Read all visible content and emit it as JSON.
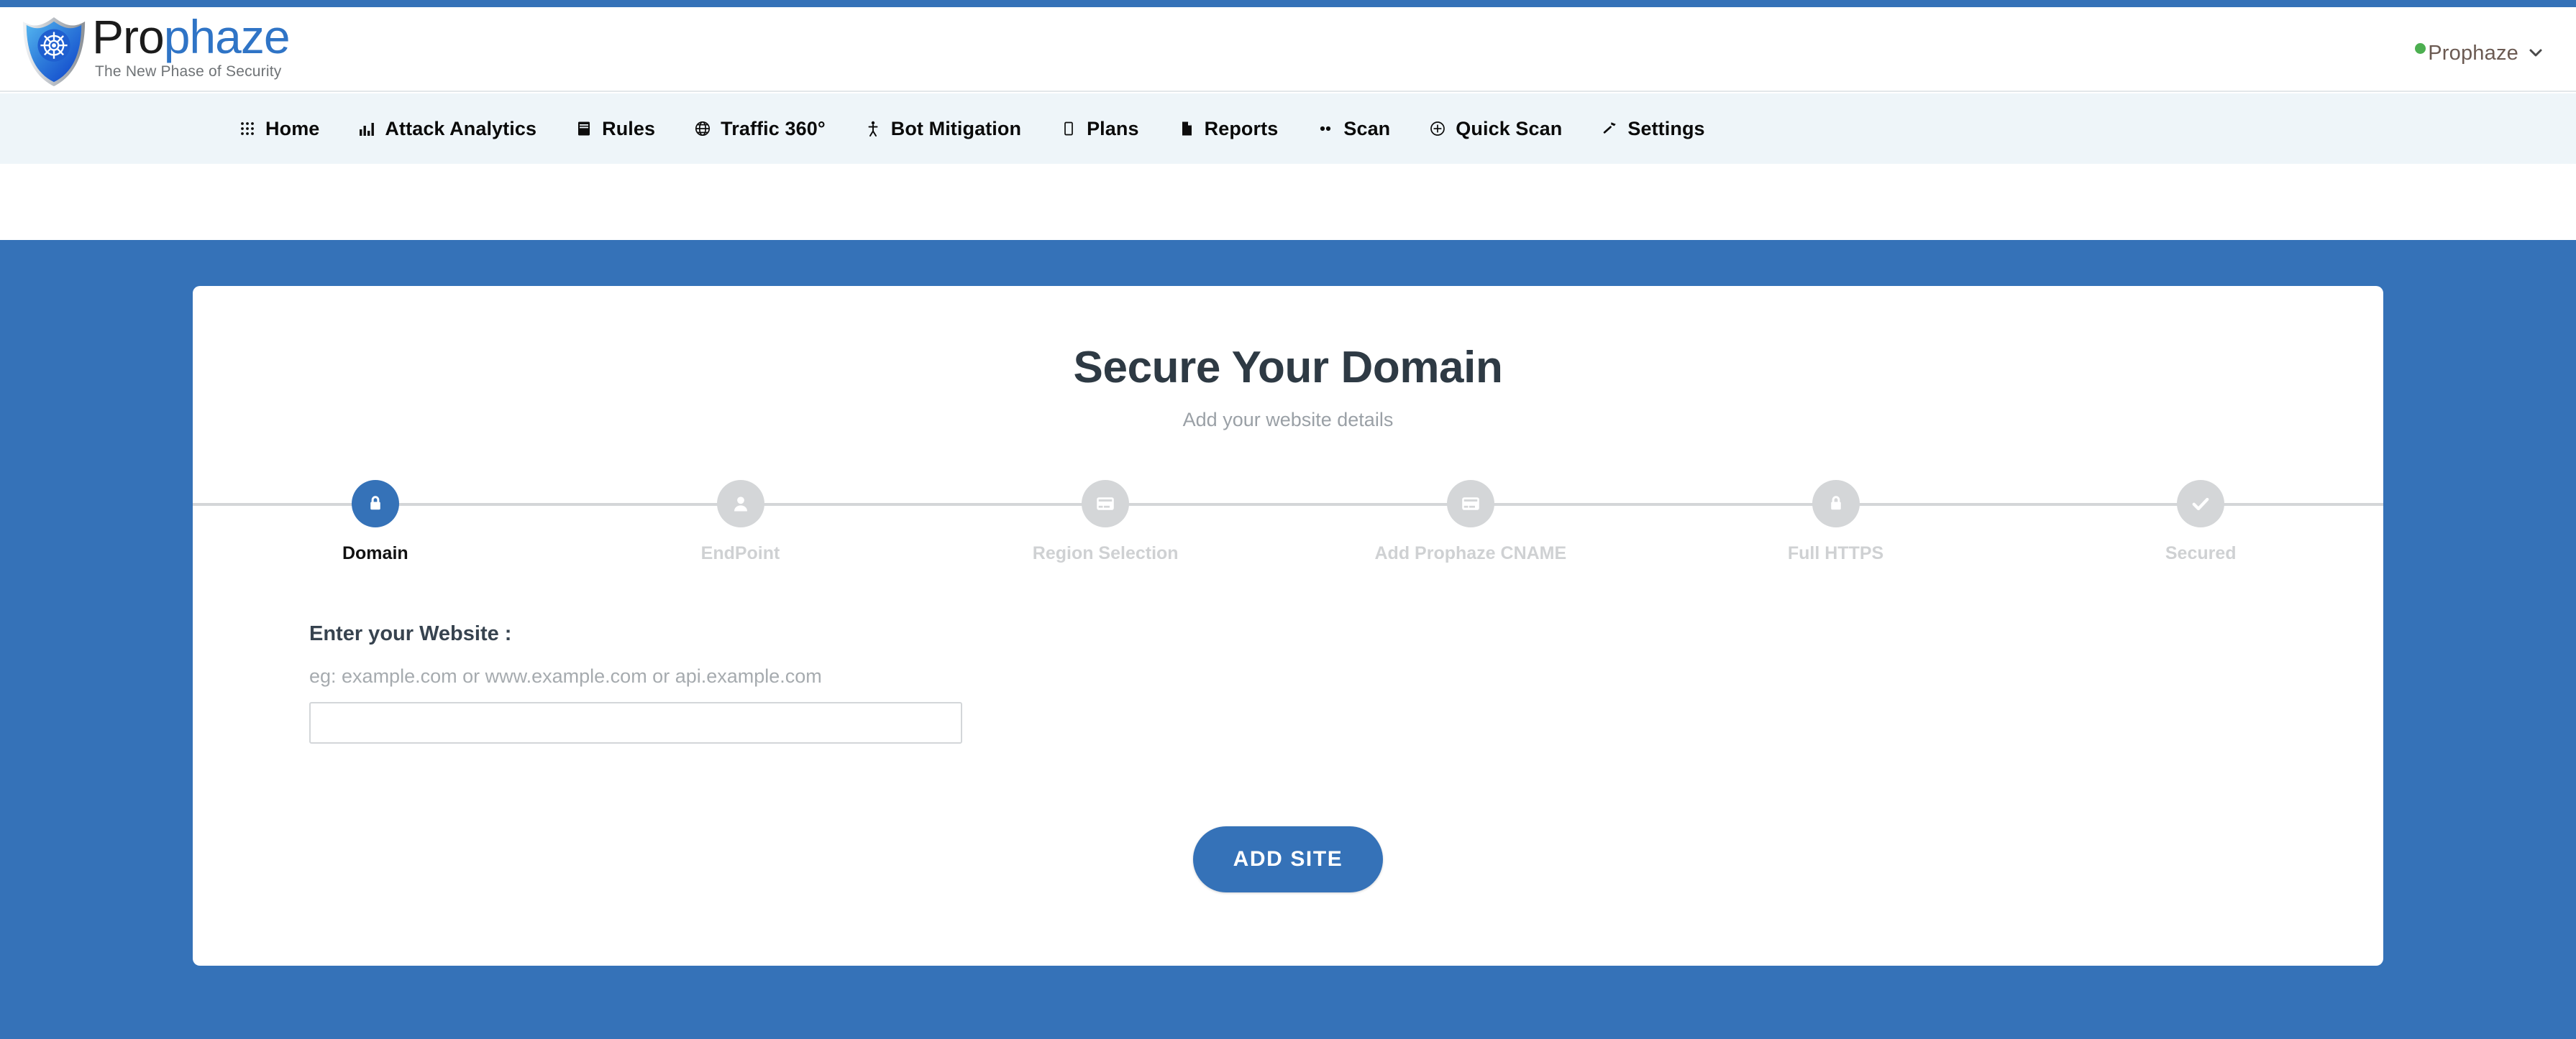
{
  "brand": {
    "name_prefix": "Pro",
    "name_suffix": "phaze",
    "tagline": "The New Phase of Security",
    "logo_icon": "shield-helm-icon"
  },
  "header": {
    "user_label": "Prophaze",
    "status_dot_color": "#4caf50",
    "chevron": "⌄"
  },
  "nav": {
    "items": [
      {
        "label": "Home",
        "icon": "grid-icon"
      },
      {
        "label": "Attack Analytics",
        "icon": "bar-chart-icon"
      },
      {
        "label": "Rules",
        "icon": "book-icon"
      },
      {
        "label": "Traffic 360°",
        "icon": "globe-icon"
      },
      {
        "label": "Bot Mitigation",
        "icon": "person-icon"
      },
      {
        "label": "Plans",
        "icon": "card-outline-icon"
      },
      {
        "label": "Reports",
        "icon": "document-icon"
      },
      {
        "label": "Scan",
        "icon": "eyes-icon"
      },
      {
        "label": "Quick Scan",
        "icon": "plus-circle-icon"
      },
      {
        "label": "Settings",
        "icon": "hammer-icon"
      }
    ]
  },
  "card": {
    "title": "Secure Your Domain",
    "subtitle": "Add your website details",
    "steps": [
      {
        "label": "Domain",
        "icon": "lock-icon",
        "state": "active"
      },
      {
        "label": "EndPoint",
        "icon": "user-icon",
        "state": "inactive"
      },
      {
        "label": "Region Selection",
        "icon": "credit-card-icon",
        "state": "inactive"
      },
      {
        "label": "Add Prophaze CNAME",
        "icon": "credit-card-icon",
        "state": "inactive"
      },
      {
        "label": "Full HTTPS",
        "icon": "lock-icon",
        "state": "inactive"
      },
      {
        "label": "Secured",
        "icon": "check-icon",
        "state": "inactive"
      }
    ],
    "form": {
      "label": "Enter your Website :",
      "hint": "eg: example.com or www.example.com or api.example.com",
      "input_value": "",
      "input_placeholder": ""
    },
    "submit_label": "ADD SITE"
  },
  "colors": {
    "accent": "#3572b8",
    "nav_band": "#eef5f9",
    "step_inactive": "#d4d6d8",
    "title": "#2e3a44"
  }
}
